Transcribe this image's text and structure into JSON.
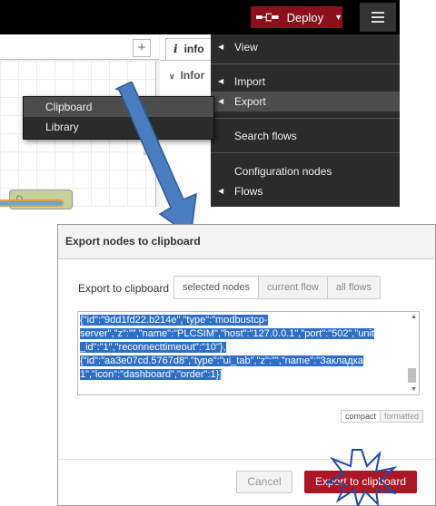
{
  "header": {
    "deploy_label": "Deploy",
    "deploy_color": "#8c101c"
  },
  "workspace": {
    "add_tab": "+",
    "node_label": "D"
  },
  "info_panel": {
    "tab_icon": "i",
    "tab_label": "info",
    "row_label": "Infor"
  },
  "main_menu": {
    "items": {
      "view": "View",
      "import": "Import",
      "export": "Export",
      "search_flows": "Search flows",
      "configuration_nodes": "Configuration nodes",
      "flows": "Flows"
    }
  },
  "export_submenu": {
    "clipboard": "Clipboard",
    "library": "Library"
  },
  "dialog": {
    "title": "Export nodes to clipboard",
    "export_label": "Export to clipboard",
    "scope_options": [
      "selected nodes",
      "current flow",
      "all flows"
    ],
    "scope_selected": "selected nodes",
    "json_lines": [
      "{\"id\":\"9dd1fd22.b214e\",\"type\":\"modbustcp-",
      "server\",\"z\":\"\",\"name\":\"PLCSIM\",\"host\":\"127.0.0.1\",\"port\":\"502\",\"unit",
      "_id\":\"1\",\"reconnecttimeout\":\"10\"},",
      "{\"id\":\"aa3e07cd.5767d8\",\"type\":\"ui_tab\",\"z\":\"\",\"name\":\"Закладка",
      "1\",\"icon\":\"dashboard\",\"order\":1}]"
    ],
    "format_options": [
      "compact",
      "formatted"
    ],
    "format_selected": "compact",
    "cancel_label": "Cancel",
    "export_label_btn": "Export to clipboard",
    "accent_color": "#ad1625"
  }
}
